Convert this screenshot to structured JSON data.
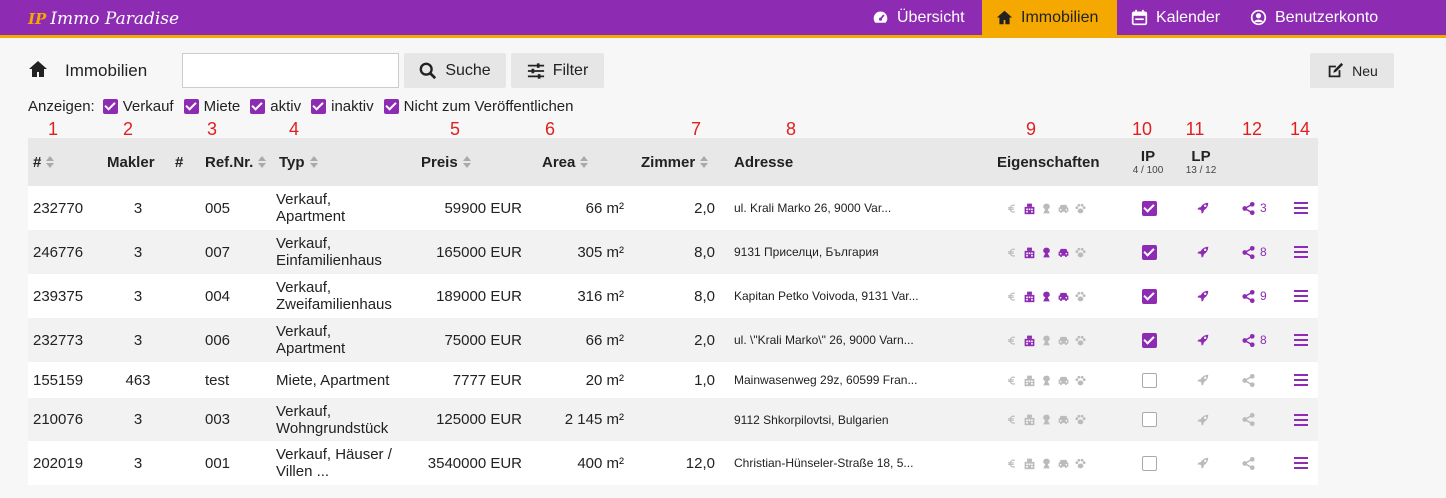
{
  "app": {
    "logo_mark": "IP",
    "logo_text": "Immo Paradise"
  },
  "nav": {
    "items": [
      {
        "label": "Übersicht",
        "icon": "dashboard-icon",
        "active": false
      },
      {
        "label": "Immobilien",
        "icon": "home-icon",
        "active": true
      },
      {
        "label": "Kalender",
        "icon": "calendar-icon",
        "active": false
      },
      {
        "label": "Benutzerkonto",
        "icon": "user-circle-icon",
        "active": false
      }
    ]
  },
  "toolbar": {
    "title": "Immobilien",
    "search_value": "",
    "search_label": "Suche",
    "filter_label": "Filter",
    "new_label": "Neu"
  },
  "filters": {
    "label": "Anzeigen:",
    "options": [
      {
        "label": "Verkauf",
        "checked": true
      },
      {
        "label": "Miete",
        "checked": true
      },
      {
        "label": "aktiv",
        "checked": true
      },
      {
        "label": "inaktiv",
        "checked": true
      },
      {
        "label": "Nicht zum Veröffentlichen",
        "checked": true
      }
    ]
  },
  "column_numbers": [
    "1",
    "2",
    "3",
    "4",
    "5",
    "6",
    "7",
    "8",
    "9",
    "10",
    "11",
    "12",
    "14"
  ],
  "table": {
    "headers": {
      "id": "#",
      "makler": "Makler",
      "hash": "#",
      "ref": "Ref.Nr.",
      "typ": "Typ",
      "preis": "Preis",
      "area": "Area",
      "zimmer": "Zimmer",
      "adresse": "Adresse",
      "eigenschaften": "Eigenschaften",
      "ip": "IP",
      "ip_sub": "4 / 100",
      "lp": "LP",
      "lp_sub": "13 / 12"
    },
    "rows": [
      {
        "id": "232770",
        "makler": "3",
        "ref": "005",
        "typ1": "Verkauf,",
        "typ2": "Apartment",
        "preis": "59900 EUR",
        "area": "66 m²",
        "zimmer": "2,0",
        "adresse": "ul. Krali Marko 26, 9000   Var...",
        "props": [
          false,
          true,
          false,
          false,
          false
        ],
        "ip": true,
        "lp": true,
        "share": "3"
      },
      {
        "id": "246776",
        "makler": "3",
        "ref": "007",
        "typ1": "Verkauf,",
        "typ2": "Einfamilienhaus",
        "preis": "165000 EUR",
        "area": "305 m²",
        "zimmer": "8,0",
        "adresse": "9131 Приселци, България",
        "props": [
          false,
          true,
          true,
          true,
          false
        ],
        "ip": true,
        "lp": true,
        "share": "8"
      },
      {
        "id": "239375",
        "makler": "3",
        "ref": "004",
        "typ1": "Verkauf,",
        "typ2": "Zweifamilienhaus",
        "preis": "189000 EUR",
        "area": "316 m²",
        "zimmer": "8,0",
        "adresse": "Kapitan Petko Voivoda, 9131 Var...",
        "props": [
          false,
          true,
          true,
          true,
          false
        ],
        "ip": true,
        "lp": true,
        "share": "9"
      },
      {
        "id": "232773",
        "makler": "3",
        "ref": "006",
        "typ1": "Verkauf,",
        "typ2": "Apartment",
        "preis": "75000 EUR",
        "area": "66 m²",
        "zimmer": "2,0",
        "adresse": "ul. \\\"Krali Marko\\\" 26, 9000 Varn...",
        "props": [
          false,
          true,
          false,
          false,
          false
        ],
        "ip": true,
        "lp": true,
        "share": "8"
      },
      {
        "id": "155159",
        "makler": "463",
        "ref": "test",
        "typ1": "Miete, Apartment",
        "typ2": "",
        "preis": "7777 EUR",
        "area": "20 m²",
        "zimmer": "1,0",
        "adresse": "Mainwasenweg 29z, 60599 Fran...",
        "props": [
          false,
          false,
          false,
          false,
          false
        ],
        "ip": false,
        "lp": false,
        "share": ""
      },
      {
        "id": "210076",
        "makler": "3",
        "ref": "003",
        "typ1": "Verkauf,",
        "typ2": "Wohngrundstück",
        "preis": "125000 EUR",
        "area": "2 145 m²",
        "zimmer": "",
        "adresse": "9112 Shkorpilovtsi, Bulgarien",
        "props": [
          false,
          false,
          false,
          false,
          false
        ],
        "ip": false,
        "lp": false,
        "share": ""
      },
      {
        "id": "202019",
        "makler": "3",
        "ref": "001",
        "typ1": "Verkauf, Häuser /",
        "typ2": "Villen ...",
        "preis": "3540000 EUR",
        "area": "400 m²",
        "zimmer": "12,0",
        "adresse": "Christian-Hünseler-Straße 18, 5...",
        "props": [
          false,
          false,
          false,
          false,
          false
        ],
        "ip": false,
        "lp": false,
        "share": ""
      }
    ]
  },
  "colors": {
    "brand": "#8e2bb3",
    "accent": "#f5a800",
    "annotation": "#e02020",
    "inactive_icon": "#bbbbbb"
  }
}
